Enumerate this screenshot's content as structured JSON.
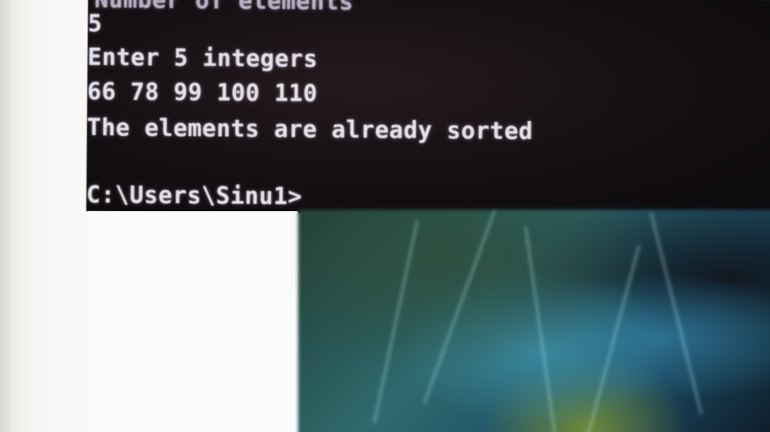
{
  "console": {
    "lines": [
      "Number of elements",
      "5",
      "Enter 5 integers",
      "66 78 99 100 110",
      "The elements are already sorted",
      "C:\\Users\\Sinu1>"
    ]
  },
  "colors": {
    "console_background": "#140f12",
    "console_text": "#e6e0ea",
    "wallpaper_teal": "#3b8aa0"
  }
}
